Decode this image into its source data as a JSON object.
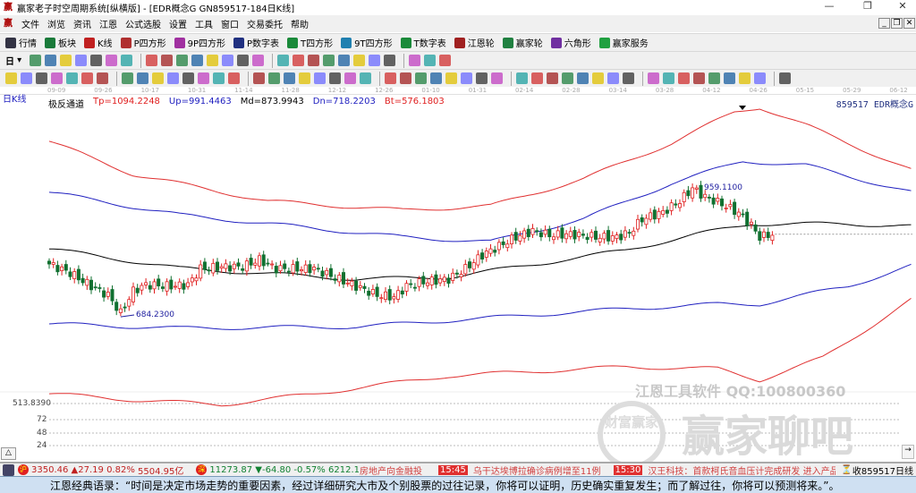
{
  "window": {
    "title": "赢家老子时空周期系统[纵横版] - [EDR概念G  GN859517-184日K线]",
    "minimize": "—",
    "restore": "❐",
    "close": "✕"
  },
  "menu": [
    "文件",
    "浏览",
    "资讯",
    "江恩",
    "公式选股",
    "设置",
    "工具",
    "窗口",
    "交易委托",
    "帮助"
  ],
  "toolbar": [
    {
      "label": "行情",
      "icon": "grid-icon",
      "color": "#334"
    },
    {
      "label": "板块",
      "icon": "blocks-icon",
      "color": "#1a7a3a"
    },
    {
      "label": "K线",
      "icon": "kline-icon",
      "color": "#c02020"
    },
    {
      "label": "P四方形",
      "icon": "p-square-icon",
      "color": "#b03030"
    },
    {
      "label": "9P四方形",
      "icon": "9p-square-icon",
      "color": "#a030a0"
    },
    {
      "label": "P数字表",
      "icon": "p-table-icon",
      "color": "#203080"
    },
    {
      "label": "T四方形",
      "icon": "t-square-icon",
      "color": "#1a8a3a"
    },
    {
      "label": "9T四方形",
      "icon": "9t-square-icon",
      "color": "#2080b0"
    },
    {
      "label": "T数字表",
      "icon": "t-table-icon",
      "color": "#1a8a3a"
    },
    {
      "label": "江恩轮",
      "icon": "gann-wheel-icon",
      "color": "#a02020"
    },
    {
      "label": "赢家轮",
      "icon": "winner-wheel-icon",
      "color": "#208040"
    },
    {
      "label": "六角形",
      "icon": "hexagon-icon",
      "color": "#7030a0"
    },
    {
      "label": "赢家服务",
      "icon": "dollar-icon",
      "color": "#20a040"
    }
  ],
  "period_selector": "日",
  "chart": {
    "period_label": "日K线",
    "indicator_name": "极反通道",
    "tp": "Tp=1094.2248",
    "up": "Up=991.4463",
    "md": "Md=873.9943",
    "dn": "Dn=718.2203",
    "bt": "Bt=576.1803",
    "symbol": "859517 EDR概念G",
    "low_label": "684.2300",
    "high_label": "959.1100",
    "axis_label": "513.8390",
    "sub_axis": [
      "72",
      "48",
      "24"
    ],
    "dates": [
      "09-09",
      "09-26",
      "10-17",
      "10-31",
      "11-14",
      "11-28",
      "12-12",
      "12-26",
      "01-10",
      "01-31",
      "02-14",
      "02-28",
      "03-14",
      "03-28",
      "04-12",
      "04-26",
      "05-15",
      "05-29",
      "06-12"
    ],
    "colors": {
      "outer": "#e03030",
      "inner": "#2020c0",
      "middle": "#000000",
      "up": "#e02020",
      "down": "#107030"
    }
  },
  "chart_data": {
    "type": "line",
    "title": "极反通道",
    "x_unit": "bar index",
    "price_range": [
      500,
      1140
    ],
    "candles_close_sampled": {
      "x": [
        0,
        5,
        10,
        14,
        17,
        20,
        23,
        29,
        33,
        36,
        41,
        46,
        50,
        54,
        59,
        63,
        68,
        73,
        78,
        82,
        85,
        89,
        95,
        99,
        103,
        107,
        111,
        115,
        119,
        124,
        130,
        135,
        138,
        141,
        146,
        150,
        153,
        156,
        160,
        164,
        167,
        169,
        172
      ],
      "y": [
        796,
        777,
        749,
        730,
        692,
        739,
        752,
        749,
        752,
        786,
        790,
        790,
        805,
        786,
        786,
        786,
        767,
        749,
        730,
        726,
        749,
        758,
        764,
        786,
        815,
        834,
        853,
        866,
        857,
        859,
        853,
        853,
        862,
        891,
        906,
        929,
        957,
        938,
        923,
        904,
        878,
        853,
        859
      ]
    },
    "series": [
      {
        "name": "Tp",
        "x": [
          0,
          20,
          52,
          84,
          105,
          127,
          148,
          163,
          169,
          180,
          205
        ],
        "y": [
          1056,
          986,
          929,
          910,
          919,
          976,
          1052,
          1118,
          1128,
          1090,
          995
        ]
      },
      {
        "name": "Up",
        "x": [
          0,
          31,
          84,
          105,
          127,
          148,
          165,
          180,
          205
        ],
        "y": [
          948,
          900,
          853,
          843,
          891,
          967,
          1014,
          1005,
          948
        ]
      },
      {
        "name": "Md",
        "x": [
          0,
          31,
          73,
          95,
          116,
          137,
          154,
          167,
          190,
          205
        ],
        "y": [
          828,
          787,
          764,
          768,
          796,
          825,
          859,
          881,
          881,
          876
        ]
      },
      {
        "name": "Dn",
        "x": [
          0,
          31,
          73,
          105,
          137,
          159,
          169,
          190,
          205
        ],
        "y": [
          669,
          660,
          663,
          682,
          701,
          711,
          711,
          749,
          792
        ]
      },
      {
        "name": "Bt",
        "x": [
          0,
          20,
          41,
          63,
          95,
          137,
          159,
          169,
          184,
          205
        ],
        "y": [
          521,
          508,
          498,
          521,
          559,
          578,
          574,
          550,
          597,
          720
        ]
      }
    ],
    "annotations": [
      "684.2300",
      "959.1100"
    ]
  },
  "watermark": {
    "line1": "江恩工具软件  QQ:100800360",
    "line2": "赢家聊吧",
    "seal": "财富赢家"
  },
  "status": {
    "sh_index": "3350.46",
    "sh_change": "▲27.19",
    "sh_pct": "0.82%",
    "sh_amount": "5504.95亿",
    "sz_index": "11273.87",
    "sz_change": "▼-64.80",
    "sz_pct": "-0.57%",
    "sz_amount": "6212.1",
    "news1": "房地产向金融投",
    "time2": "15:45",
    "news2": "乌干达埃博拉确诊病例增至11例",
    "time3": "15:30",
    "news3": "汉王科技：首款柯氏音血压计完成研发 进入产品注",
    "right": "收859517日线"
  },
  "quote": "江恩经典语录：“时间是决定市场走势的重要因素，经过详细研究大市及个别股票的过往记录，你将可以证明，历史确实重复发生；而了解过往，你将可以预测将来。”。"
}
